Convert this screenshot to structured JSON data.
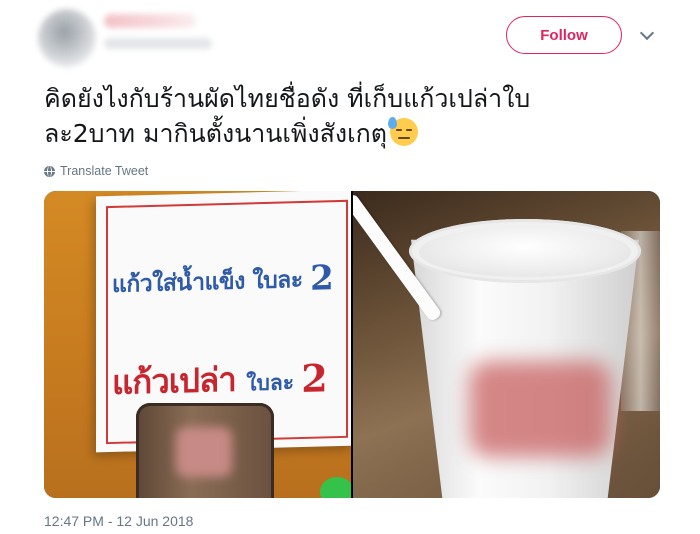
{
  "header": {
    "follow_label": "Follow"
  },
  "tweet": {
    "text": "คิดยังไงกับร้านผัดไทยชื่อดัง ที่เก็บแก้วเปล่าใบ\nละ2บาท มากินตั้งนานเพิ่งสังเกตุ",
    "emoji": "downcast-face-with-sweat",
    "translate_label": "Translate Tweet",
    "timestamp": "12:47 PM - 12 Jun 2018"
  },
  "media": {
    "sign": {
      "line1_text": "แก้วใส่น้ำแข็ง ใบละ ",
      "line1_price": "2",
      "line2_text": "แก้วเปล่า ",
      "line2_unit": "ใบละ ",
      "line2_price": "2"
    }
  },
  "colors": {
    "follow_accent": "#e0245e",
    "muted_text": "#657786",
    "sign_blue": "#2f5aa8",
    "sign_red": "#c8262e"
  }
}
